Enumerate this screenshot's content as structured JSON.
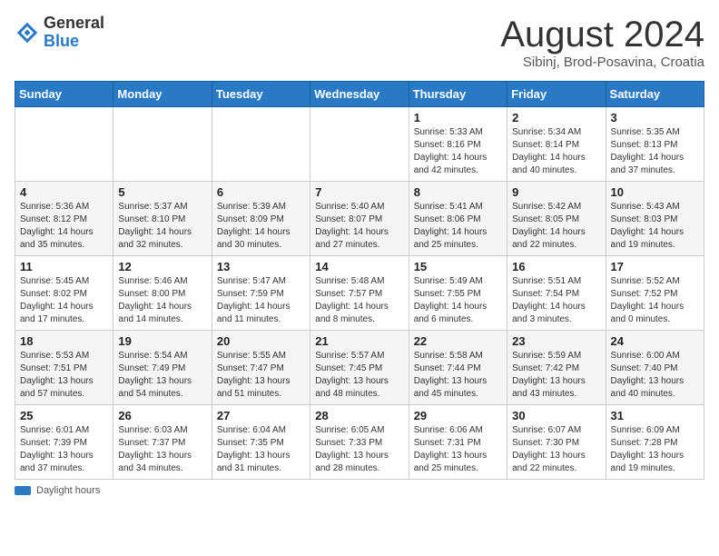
{
  "header": {
    "logo_general": "General",
    "logo_blue": "Blue",
    "month_title": "August 2024",
    "subtitle": "Sibinj, Brod-Posavina, Croatia"
  },
  "days_of_week": [
    "Sunday",
    "Monday",
    "Tuesday",
    "Wednesday",
    "Thursday",
    "Friday",
    "Saturday"
  ],
  "weeks": [
    [
      {
        "day": "",
        "info": ""
      },
      {
        "day": "",
        "info": ""
      },
      {
        "day": "",
        "info": ""
      },
      {
        "day": "",
        "info": ""
      },
      {
        "day": "1",
        "info": "Sunrise: 5:33 AM\nSunset: 8:16 PM\nDaylight: 14 hours\nand 42 minutes."
      },
      {
        "day": "2",
        "info": "Sunrise: 5:34 AM\nSunset: 8:14 PM\nDaylight: 14 hours\nand 40 minutes."
      },
      {
        "day": "3",
        "info": "Sunrise: 5:35 AM\nSunset: 8:13 PM\nDaylight: 14 hours\nand 37 minutes."
      }
    ],
    [
      {
        "day": "4",
        "info": "Sunrise: 5:36 AM\nSunset: 8:12 PM\nDaylight: 14 hours\nand 35 minutes."
      },
      {
        "day": "5",
        "info": "Sunrise: 5:37 AM\nSunset: 8:10 PM\nDaylight: 14 hours\nand 32 minutes."
      },
      {
        "day": "6",
        "info": "Sunrise: 5:39 AM\nSunset: 8:09 PM\nDaylight: 14 hours\nand 30 minutes."
      },
      {
        "day": "7",
        "info": "Sunrise: 5:40 AM\nSunset: 8:07 PM\nDaylight: 14 hours\nand 27 minutes."
      },
      {
        "day": "8",
        "info": "Sunrise: 5:41 AM\nSunset: 8:06 PM\nDaylight: 14 hours\nand 25 minutes."
      },
      {
        "day": "9",
        "info": "Sunrise: 5:42 AM\nSunset: 8:05 PM\nDaylight: 14 hours\nand 22 minutes."
      },
      {
        "day": "10",
        "info": "Sunrise: 5:43 AM\nSunset: 8:03 PM\nDaylight: 14 hours\nand 19 minutes."
      }
    ],
    [
      {
        "day": "11",
        "info": "Sunrise: 5:45 AM\nSunset: 8:02 PM\nDaylight: 14 hours\nand 17 minutes."
      },
      {
        "day": "12",
        "info": "Sunrise: 5:46 AM\nSunset: 8:00 PM\nDaylight: 14 hours\nand 14 minutes."
      },
      {
        "day": "13",
        "info": "Sunrise: 5:47 AM\nSunset: 7:59 PM\nDaylight: 14 hours\nand 11 minutes."
      },
      {
        "day": "14",
        "info": "Sunrise: 5:48 AM\nSunset: 7:57 PM\nDaylight: 14 hours\nand 8 minutes."
      },
      {
        "day": "15",
        "info": "Sunrise: 5:49 AM\nSunset: 7:55 PM\nDaylight: 14 hours\nand 6 minutes."
      },
      {
        "day": "16",
        "info": "Sunrise: 5:51 AM\nSunset: 7:54 PM\nDaylight: 14 hours\nand 3 minutes."
      },
      {
        "day": "17",
        "info": "Sunrise: 5:52 AM\nSunset: 7:52 PM\nDaylight: 14 hours\nand 0 minutes."
      }
    ],
    [
      {
        "day": "18",
        "info": "Sunrise: 5:53 AM\nSunset: 7:51 PM\nDaylight: 13 hours\nand 57 minutes."
      },
      {
        "day": "19",
        "info": "Sunrise: 5:54 AM\nSunset: 7:49 PM\nDaylight: 13 hours\nand 54 minutes."
      },
      {
        "day": "20",
        "info": "Sunrise: 5:55 AM\nSunset: 7:47 PM\nDaylight: 13 hours\nand 51 minutes."
      },
      {
        "day": "21",
        "info": "Sunrise: 5:57 AM\nSunset: 7:45 PM\nDaylight: 13 hours\nand 48 minutes."
      },
      {
        "day": "22",
        "info": "Sunrise: 5:58 AM\nSunset: 7:44 PM\nDaylight: 13 hours\nand 45 minutes."
      },
      {
        "day": "23",
        "info": "Sunrise: 5:59 AM\nSunset: 7:42 PM\nDaylight: 13 hours\nand 43 minutes."
      },
      {
        "day": "24",
        "info": "Sunrise: 6:00 AM\nSunset: 7:40 PM\nDaylight: 13 hours\nand 40 minutes."
      }
    ],
    [
      {
        "day": "25",
        "info": "Sunrise: 6:01 AM\nSunset: 7:39 PM\nDaylight: 13 hours\nand 37 minutes."
      },
      {
        "day": "26",
        "info": "Sunrise: 6:03 AM\nSunset: 7:37 PM\nDaylight: 13 hours\nand 34 minutes."
      },
      {
        "day": "27",
        "info": "Sunrise: 6:04 AM\nSunset: 7:35 PM\nDaylight: 13 hours\nand 31 minutes."
      },
      {
        "day": "28",
        "info": "Sunrise: 6:05 AM\nSunset: 7:33 PM\nDaylight: 13 hours\nand 28 minutes."
      },
      {
        "day": "29",
        "info": "Sunrise: 6:06 AM\nSunset: 7:31 PM\nDaylight: 13 hours\nand 25 minutes."
      },
      {
        "day": "30",
        "info": "Sunrise: 6:07 AM\nSunset: 7:30 PM\nDaylight: 13 hours\nand 22 minutes."
      },
      {
        "day": "31",
        "info": "Sunrise: 6:09 AM\nSunset: 7:28 PM\nDaylight: 13 hours\nand 19 minutes."
      }
    ]
  ],
  "footer": {
    "daylight_label": "Daylight hours"
  }
}
